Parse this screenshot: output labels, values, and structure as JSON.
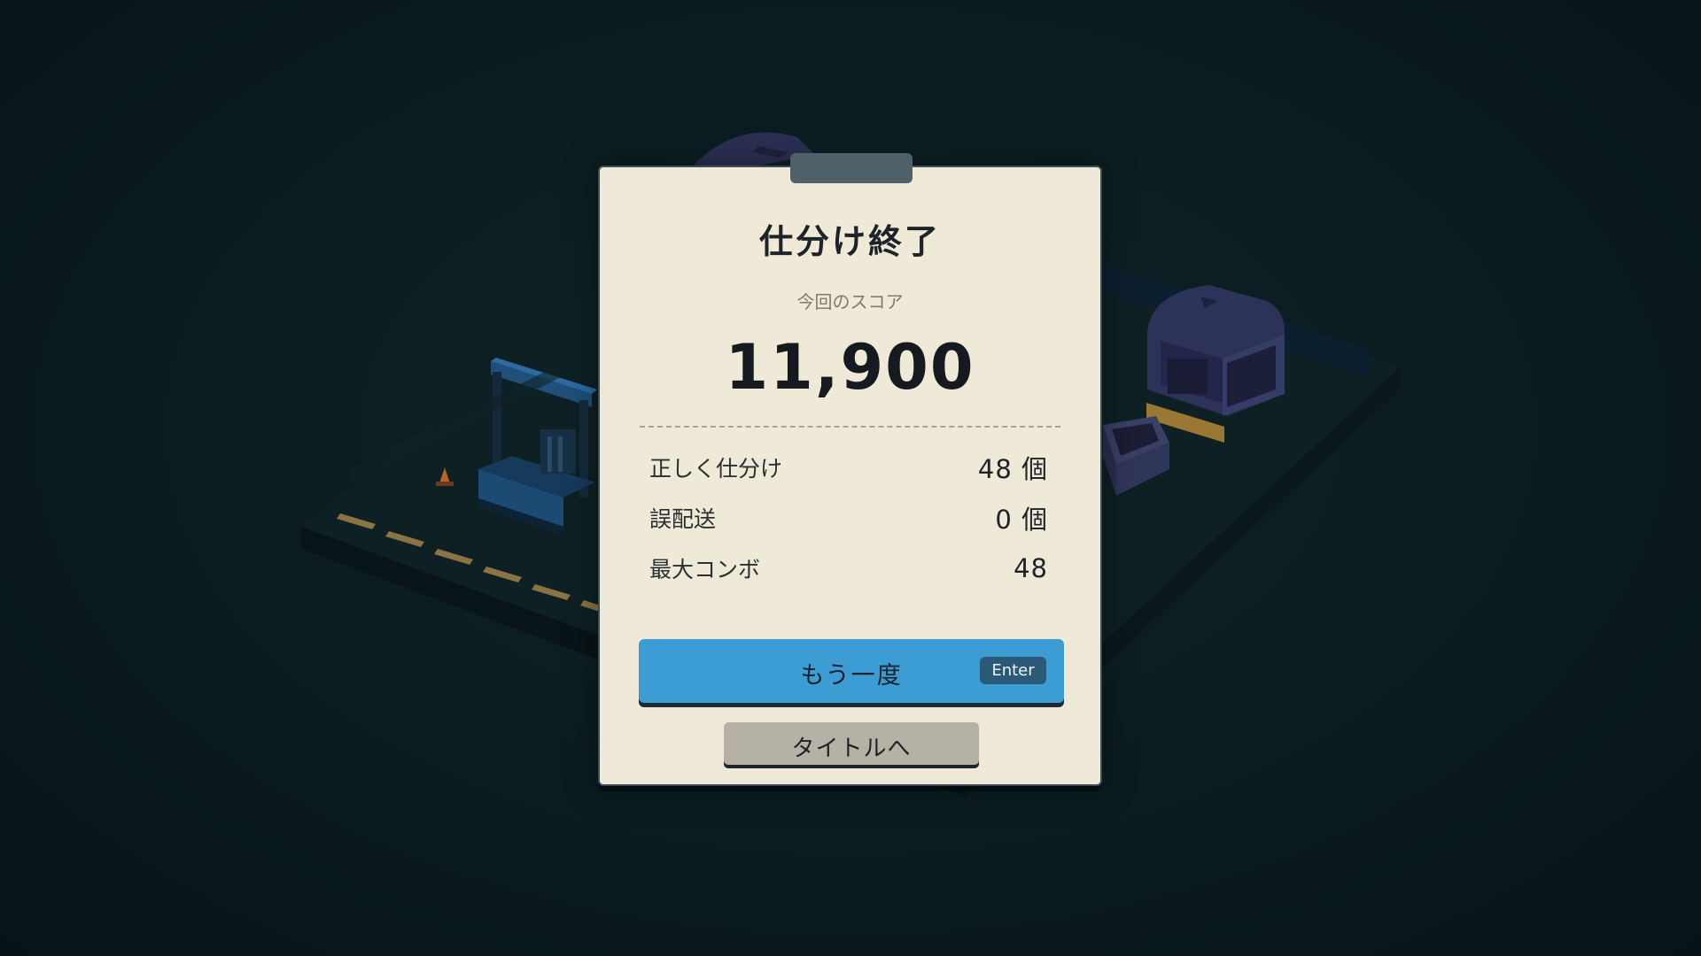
{
  "result": {
    "title": "仕分け終了",
    "score_label": "今回のスコア",
    "score": "11,900"
  },
  "stats": [
    {
      "label": "正しく仕分け",
      "value": "48 個"
    },
    {
      "label": "誤配送",
      "value": "0 個"
    },
    {
      "label": "最大コンボ",
      "value": "48"
    }
  ],
  "buttons": {
    "retry_label": "もう一度",
    "retry_key": "Enter",
    "title_label": "タイトルへ"
  },
  "colors": {
    "card": "#efead7",
    "retry_button": "#3c9dd4",
    "title_button": "#b5b2a5",
    "background": "#0a1a1e"
  }
}
